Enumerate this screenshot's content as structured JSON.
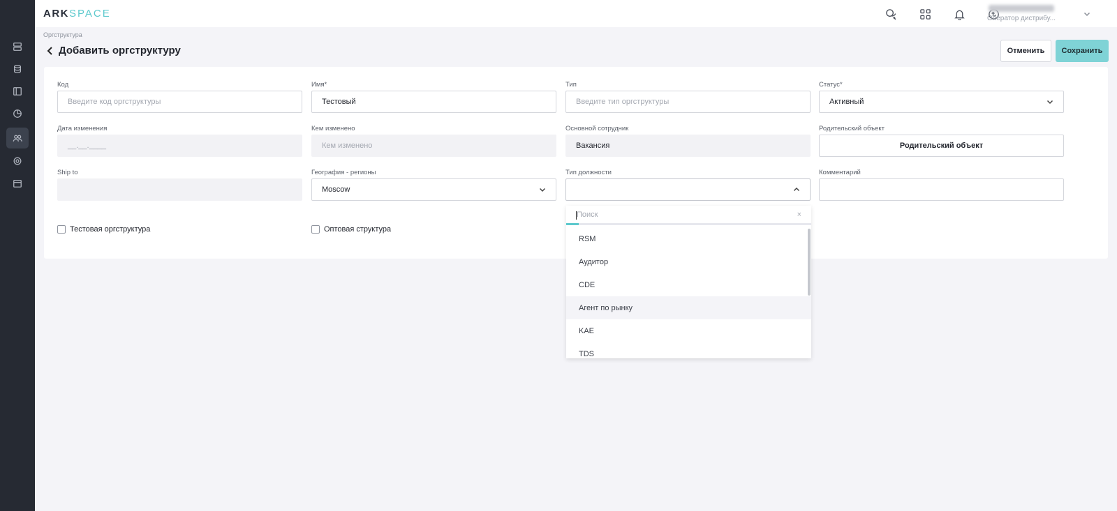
{
  "brand": {
    "part1": "ARK",
    "part2": "SPACE"
  },
  "sidebar": {
    "items": [
      {
        "icon": "server-icon"
      },
      {
        "icon": "database-icon"
      },
      {
        "icon": "layout-icon"
      },
      {
        "icon": "pie-chart-icon"
      },
      {
        "icon": "users-icon",
        "active": true
      },
      {
        "icon": "settings-icon"
      },
      {
        "icon": "calendar-icon"
      }
    ]
  },
  "topbar": {
    "icons": [
      "chat-icon",
      "apps-grid-icon",
      "bell-icon",
      "sync-icon"
    ],
    "user_role": "Оператор дистрибу..."
  },
  "breadcrumb": "Оргструктура",
  "page_title": "Добавить оргструктуру",
  "actions": {
    "cancel": "Отменить",
    "save": "Сохранить"
  },
  "form": {
    "code": {
      "label": "Код",
      "placeholder": "Введите код оргструктуры"
    },
    "name": {
      "label": "Имя*",
      "value": "Тестовый"
    },
    "type": {
      "label": "Тип",
      "placeholder": "Введите тип оргструктуры"
    },
    "status": {
      "label": "Статус*",
      "value": "Активный"
    },
    "changed_date": {
      "label": "Дата изменения",
      "placeholder": "__.__.____"
    },
    "changed_by": {
      "label": "Кем изменено",
      "placeholder": "Кем изменено"
    },
    "main_employee": {
      "label": "Основной сотрудник",
      "value": "Вакансия"
    },
    "parent": {
      "label": "Родительский объект",
      "button": "Родительский объект"
    },
    "ship_to": {
      "label": "Ship to",
      "value": ""
    },
    "geography": {
      "label": "География - регионы",
      "value": "Moscow"
    },
    "position_type": {
      "label": "Тип должности",
      "value": ""
    },
    "comment": {
      "label": "Комментарий",
      "value": ""
    },
    "test_checkbox": {
      "label": "Тестовая оргструктура",
      "checked": false
    },
    "wholesale_checkbox": {
      "label": "Оптовая структура",
      "checked": false
    }
  },
  "dropdown": {
    "search_placeholder": "Поиск",
    "clear": "×",
    "options": [
      "RSM",
      "Аудитор",
      "CDE",
      "Агент по рынку",
      "KAE",
      "TDS"
    ],
    "hovered_index": 3
  },
  "colors": {
    "sidebar_bg": "#262a33",
    "accent": "#5dc9cd",
    "save_button": "#7fd3d6"
  }
}
